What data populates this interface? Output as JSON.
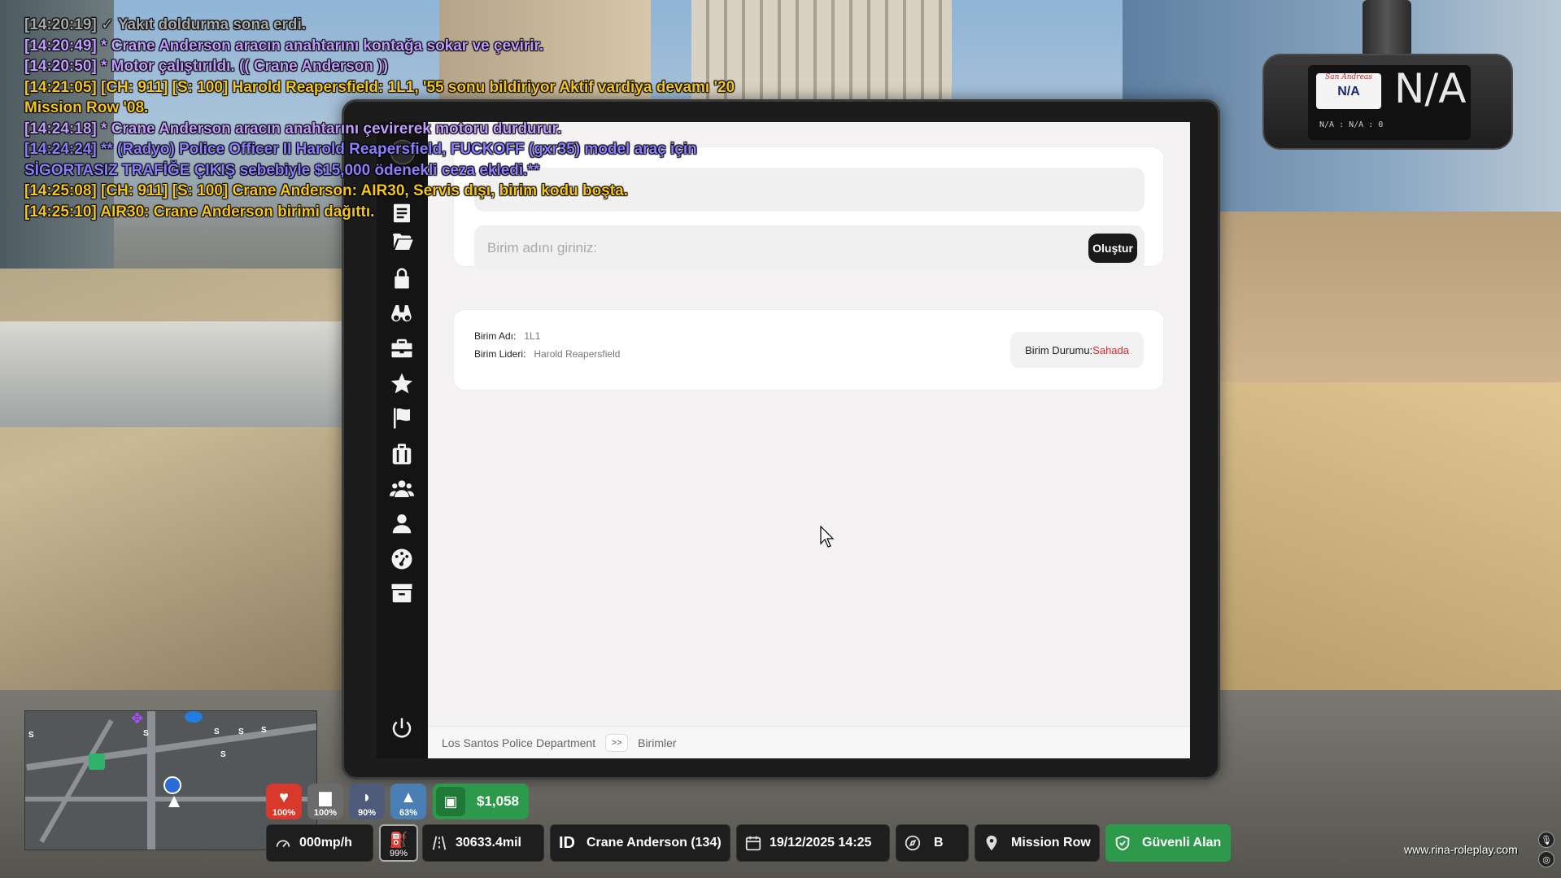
{
  "chat": [
    {
      "text": "[14:20:19] ✓ Yakıt doldurma sona erdi.",
      "color": "#a8a8a8"
    },
    {
      "text": "[14:20:49] * Crane Anderson aracın anahtarını kontağa sokar ve çevirir.",
      "color": "#c29bff"
    },
    {
      "text": "[14:20:50] * Motor çalıştırıldı. (( Crane Anderson ))",
      "color": "#c29bff"
    },
    {
      "text": "[14:21:05] [CH: 911] [S: 100] Harold Reapersfield: 1L1, '55 sonu bildiriyor Aktif vardiya devamı '20",
      "color": "#f5c518"
    },
    {
      "text": "Mission Row '08.",
      "color": "#f5c518"
    },
    {
      "text": "[14:24:18] * Crane Anderson aracın anahtarını çevirerek motoru durdurur.",
      "color": "#c29bff"
    },
    {
      "text": "[14:24:24] ** (Radyo) Police Officer II Harold Reapersfield, FUCKOFF (gxr35) model araç için",
      "color": "#8d7dff"
    },
    {
      "text": "SİGORTASIZ TRAFİĞE ÇIKIŞ sebebiyle $15,000 ödenekli ceza ekledi.**",
      "color": "#8d7dff"
    },
    {
      "text": "[14:25:08] [CH: 911] [S: 100] Crane Anderson: AIR30, Servis dışı, birim kodu boşta.",
      "color": "#f5c518"
    },
    {
      "text": "[14:25:10] AIR30: Crane Anderson birimi dağıttı.",
      "color": "#f5c518"
    }
  ],
  "dashcam": {
    "plate_state": "San Andreas",
    "plate_number": "N/A",
    "big_text": "N/A",
    "small_text": "N/A : N/A : 0"
  },
  "tablet": {
    "sidebar_icons": [
      "notes-icon",
      "file-icon",
      "folder-open-icon",
      "lock-icon",
      "binoculars-icon",
      "briefcase-icon",
      "star-icon",
      "flag-icon",
      "suitcase-icon",
      "users-icon",
      "user-icon",
      "dashboard-icon",
      "archive-icon"
    ],
    "create": {
      "placeholder": "Birim adını giriniz:",
      "button_label": "Oluştur"
    },
    "unit": {
      "name_label": "Birim Adı:",
      "name_value": "1L1",
      "leader_label": "Birim Lideri:",
      "leader_value": "Harold Reapersfield",
      "status_label": "Birim Durumu:",
      "status_value": "Sahada",
      "status_color": "#e0262b"
    },
    "breadcrumb": {
      "root": "Los Santos Police Department",
      "separator": ">>",
      "current": "Birimler"
    }
  },
  "minimap": {
    "labels": [
      "S",
      "S",
      "S",
      "S",
      "S",
      "S"
    ]
  },
  "stats": [
    {
      "name": "health",
      "value": "100%",
      "color": "#d8392b",
      "icon": "♥"
    },
    {
      "name": "armor",
      "value": "100%",
      "color": "#6b6b6b",
      "icon": "▆"
    },
    {
      "name": "hunger",
      "value": "90%",
      "color": "#4f5b7a",
      "icon": "◗"
    },
    {
      "name": "thirst",
      "value": "63%",
      "color": "#4a7fb5",
      "icon": "▲"
    }
  ],
  "money": "$1,058",
  "hud": {
    "speed": "000mp/h",
    "fuel": "99%",
    "odometer": "30633.4mil",
    "id_label": "ID",
    "player": "Crane Anderson (134)",
    "datetime": "19/12/2025 14:25",
    "direction": "B",
    "location": "Mission Row",
    "zone": "Güvenli Alan"
  },
  "watermark": "www.rina-roleplay.com"
}
